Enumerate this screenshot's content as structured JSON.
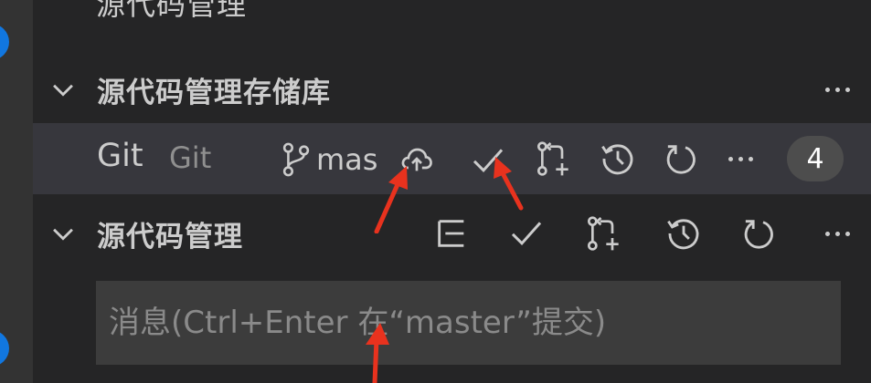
{
  "top_clipped_text": "源代码管理",
  "repositories_section": {
    "title": "源代码管理存储库",
    "repo": {
      "name": "Git",
      "provider": "Git",
      "branch": "mas",
      "change_count": "4"
    }
  },
  "scm_section": {
    "title": "源代码管理",
    "message_placeholder": "消息(Ctrl+Enter 在“master”提交)"
  },
  "icons": {
    "chevron": "chevron-down-icon",
    "branch": "git-branch-icon",
    "publish": "cloud-upload-icon",
    "commit": "check-icon",
    "pull_request": "git-pull-request-create-icon",
    "history": "history-icon",
    "refresh": "refresh-icon",
    "more": "ellipsis-icon",
    "view_as_tree": "list-tree-icon"
  },
  "colors": {
    "sidebar_bg": "#252526",
    "activity_bar_bg": "#333333",
    "selected_row_bg": "#37373d",
    "input_bg": "#3c3c3c",
    "badge_blue": "#1177e0",
    "annotation_arrow": "#e8321e"
  }
}
